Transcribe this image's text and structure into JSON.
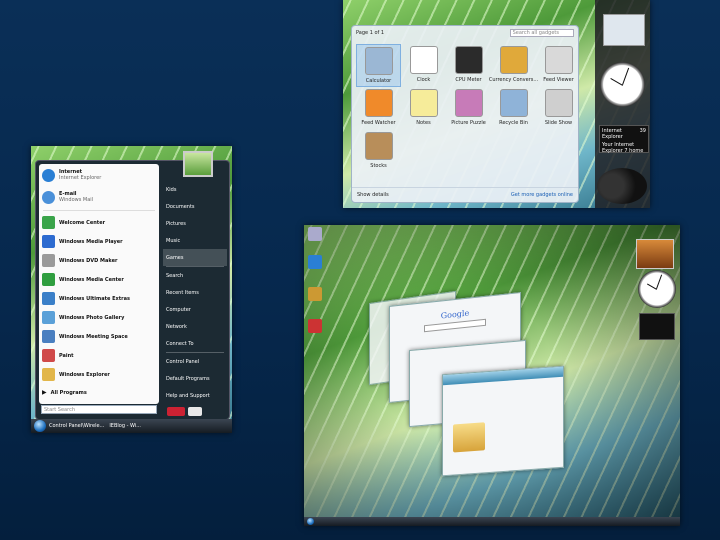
{
  "gadget_gallery": {
    "page_label": "Page 1 of 1",
    "search_placeholder": "Search all gadgets",
    "gadgets": [
      {
        "label": "Calculator",
        "icon": "calculator-icon",
        "color": "#9bb7d4"
      },
      {
        "label": "Clock",
        "icon": "clock-icon",
        "color": "#ffffff"
      },
      {
        "label": "CPU Meter",
        "icon": "cpu-meter-icon",
        "color": "#2b2b2b"
      },
      {
        "label": "Currency Convers...",
        "icon": "currency-icon",
        "color": "#e0a93a"
      },
      {
        "label": "Feed Viewer",
        "icon": "feed-viewer-icon",
        "color": "#d9d9d9"
      },
      {
        "label": "Feed Watcher",
        "icon": "feed-watcher-icon",
        "color": "#f08a2a"
      },
      {
        "label": "Notes",
        "icon": "notes-icon",
        "color": "#f6ec9a"
      },
      {
        "label": "Picture Puzzle",
        "icon": "picture-puzzle-icon",
        "color": "#c77bb8"
      },
      {
        "label": "Recycle Bin",
        "icon": "recycle-bin-icon",
        "color": "#8fb3d8"
      },
      {
        "label": "Slide Show",
        "icon": "slide-show-icon",
        "color": "#cfcfcf"
      },
      {
        "label": "Stocks",
        "icon": "stocks-icon",
        "color": "#b88e5a"
      }
    ],
    "show_details": "Show details",
    "get_more": "Get more gadgets online",
    "sidebar_feed_title": "Internet Explorer",
    "sidebar_feed_count": "39",
    "sidebar_feed_text": "Your Internet Explorer 7 home"
  },
  "start_menu": {
    "pinned": [
      {
        "title": "Internet",
        "subtitle": "Internet Explorer",
        "icon": "internet-explorer-icon",
        "color": "#2a7fd4"
      },
      {
        "title": "E-mail",
        "subtitle": "Windows Mail",
        "icon": "mail-icon",
        "color": "#4a90d9"
      }
    ],
    "programs": [
      {
        "label": "Welcome Center",
        "icon": "welcome-center-icon",
        "color": "#3aa44a"
      },
      {
        "label": "Windows Media Player",
        "icon": "media-player-icon",
        "color": "#2d6bd0"
      },
      {
        "label": "Windows DVD Maker",
        "icon": "dvd-maker-icon",
        "color": "#9a9a9a"
      },
      {
        "label": "Windows Media Center",
        "icon": "media-center-icon",
        "color": "#2f9e3f"
      },
      {
        "label": "Windows Ultimate Extras",
        "icon": "ultimate-extras-icon",
        "color": "#3a7fc8"
      },
      {
        "label": "Windows Photo Gallery",
        "icon": "photo-gallery-icon",
        "color": "#5aa0d8"
      },
      {
        "label": "Windows Meeting Space",
        "icon": "meeting-space-icon",
        "color": "#4a7fc0"
      },
      {
        "label": "Paint",
        "icon": "paint-icon",
        "color": "#d04a4a"
      },
      {
        "label": "Windows Explorer",
        "icon": "explorer-icon",
        "color": "#e2b64a"
      }
    ],
    "all_programs": "All Programs",
    "search_placeholder": "Start Search",
    "right_items": [
      "Kids",
      "Documents",
      "Pictures",
      "Music",
      "Games",
      "Search",
      "Recent Items",
      "Computer",
      "Network",
      "Connect To",
      "Control Panel",
      "Default Programs",
      "Help and Support"
    ],
    "taskbar": [
      "Control Panel\\Wirele...",
      "IEBlog - Wi..."
    ]
  },
  "flip3d": {
    "google_logo": "Google"
  }
}
